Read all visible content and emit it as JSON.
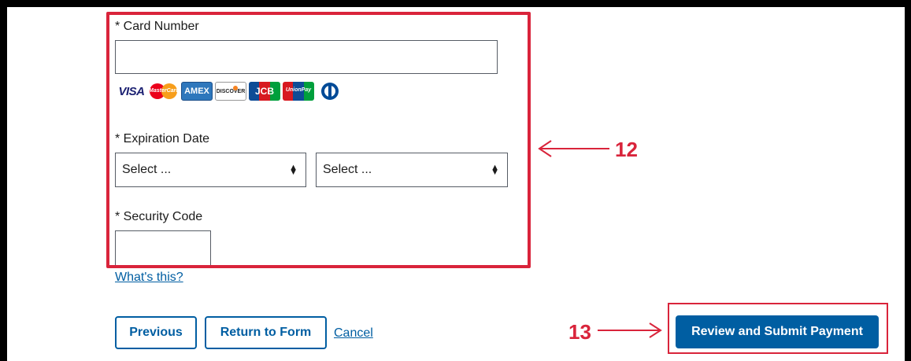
{
  "card_number": {
    "label": "* Card Number",
    "value": ""
  },
  "card_logos": [
    "visa-logo",
    "mastercard-logo",
    "amex-logo",
    "discover-logo",
    "jcb-logo",
    "unionpay-logo",
    "diners-logo"
  ],
  "card_logo_text": {
    "visa": "VISA",
    "mastercard": "MasterCard",
    "amex": "AMEX",
    "discover": "DISCOVER",
    "jcb": "JCB",
    "unionpay": "UnionPay"
  },
  "expiration": {
    "label": "* Expiration Date",
    "month_value": "Select ...",
    "year_value": "Select ..."
  },
  "security": {
    "label": "* Security Code",
    "value": "",
    "help_link": "What's this?"
  },
  "buttons": {
    "previous": "Previous",
    "return_to_form": "Return to Form",
    "cancel": "Cancel",
    "review_submit": "Review and Submit Payment"
  },
  "annotations": {
    "callout_12": "12",
    "callout_13": "13",
    "color": "#d9243b"
  },
  "colors": {
    "primary": "#005ea2",
    "annotation": "#d9243b"
  }
}
